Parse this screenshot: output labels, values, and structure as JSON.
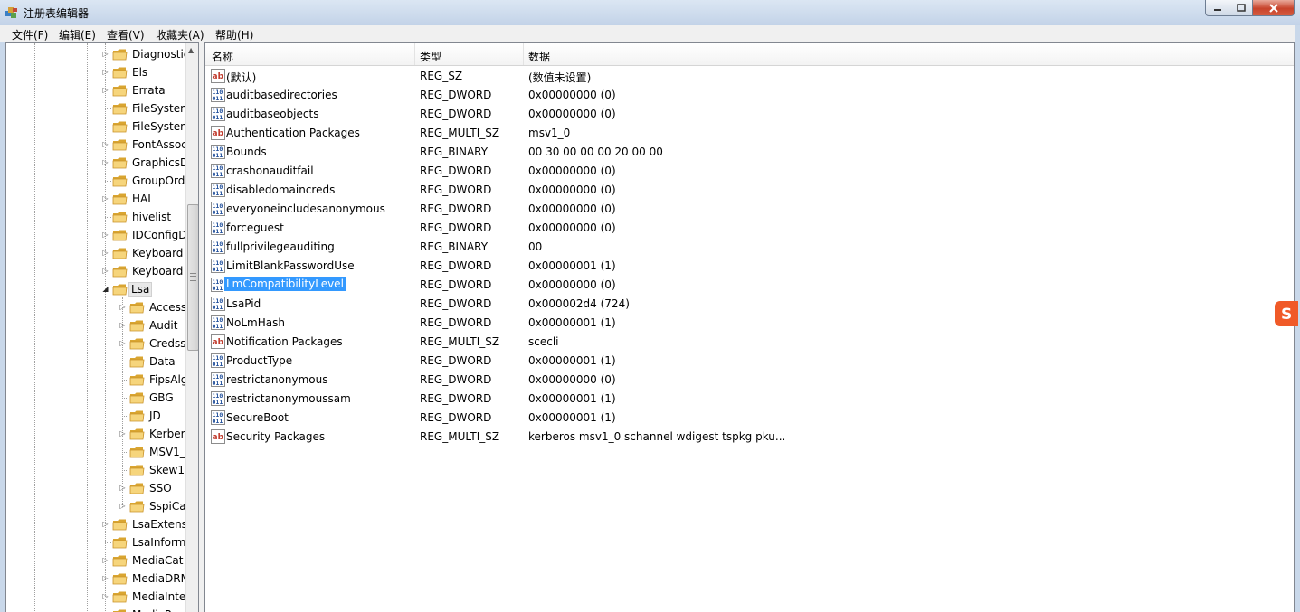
{
  "window": {
    "title": "注册表编辑器"
  },
  "menu": [
    "文件(F)",
    "编辑(E)",
    "查看(V)",
    "收藏夹(A)",
    "帮助(H)"
  ],
  "tree": {
    "items": [
      {
        "label": "Diagnostic",
        "level": 1,
        "expandable": true
      },
      {
        "label": "Els",
        "level": 1,
        "expandable": true
      },
      {
        "label": "Errata",
        "level": 1,
        "expandable": true
      },
      {
        "label": "FileSystem",
        "level": 1,
        "expandable": false
      },
      {
        "label": "FileSystem",
        "level": 1,
        "expandable": false
      },
      {
        "label": "FontAssoc",
        "level": 1,
        "expandable": true
      },
      {
        "label": "GraphicsD",
        "level": 1,
        "expandable": true
      },
      {
        "label": "GroupOrd",
        "level": 1,
        "expandable": false
      },
      {
        "label": "HAL",
        "level": 1,
        "expandable": true
      },
      {
        "label": "hivelist",
        "level": 1,
        "expandable": false
      },
      {
        "label": "IDConfigD",
        "level": 1,
        "expandable": true
      },
      {
        "label": "Keyboard",
        "level": 1,
        "expandable": true
      },
      {
        "label": "Keyboard",
        "level": 1,
        "expandable": true
      },
      {
        "label": "Lsa",
        "level": 1,
        "expandable": true,
        "expanded": true,
        "selected": true
      },
      {
        "label": "Access",
        "level": 2,
        "expandable": true
      },
      {
        "label": "Audit",
        "level": 2,
        "expandable": true
      },
      {
        "label": "Credss",
        "level": 2,
        "expandable": true
      },
      {
        "label": "Data",
        "level": 2,
        "expandable": false
      },
      {
        "label": "FipsAlg",
        "level": 2,
        "expandable": false
      },
      {
        "label": "GBG",
        "level": 2,
        "expandable": false
      },
      {
        "label": "JD",
        "level": 2,
        "expandable": false
      },
      {
        "label": "Kerber",
        "level": 2,
        "expandable": true
      },
      {
        "label": "MSV1_",
        "level": 2,
        "expandable": false
      },
      {
        "label": "Skew1",
        "level": 2,
        "expandable": false
      },
      {
        "label": "SSO",
        "level": 2,
        "expandable": true
      },
      {
        "label": "SspiCa",
        "level": 2,
        "expandable": true
      },
      {
        "label": "LsaExtens",
        "level": 1,
        "expandable": true
      },
      {
        "label": "LsaInform",
        "level": 1,
        "expandable": false
      },
      {
        "label": "MediaCat",
        "level": 1,
        "expandable": true
      },
      {
        "label": "MediaDRM",
        "level": 1,
        "expandable": true
      },
      {
        "label": "MediaInte",
        "level": 1,
        "expandable": true
      },
      {
        "label": "MediaP",
        "level": 1,
        "expandable": true
      }
    ]
  },
  "list": {
    "columns": [
      "名称",
      "类型",
      "数据"
    ],
    "rows": [
      {
        "icon": "string-value-icon",
        "name": "(默认)",
        "type": "REG_SZ",
        "data": "(数值未设置)"
      },
      {
        "icon": "binary-value-icon",
        "name": "auditbasedirectories",
        "type": "REG_DWORD",
        "data": "0x00000000 (0)"
      },
      {
        "icon": "binary-value-icon",
        "name": "auditbaseobjects",
        "type": "REG_DWORD",
        "data": "0x00000000 (0)"
      },
      {
        "icon": "string-value-icon",
        "name": "Authentication Packages",
        "type": "REG_MULTI_SZ",
        "data": "msv1_0"
      },
      {
        "icon": "binary-value-icon",
        "name": "Bounds",
        "type": "REG_BINARY",
        "data": "00 30 00 00 00 20 00 00"
      },
      {
        "icon": "binary-value-icon",
        "name": "crashonauditfail",
        "type": "REG_DWORD",
        "data": "0x00000000 (0)"
      },
      {
        "icon": "binary-value-icon",
        "name": "disabledomaincreds",
        "type": "REG_DWORD",
        "data": "0x00000000 (0)"
      },
      {
        "icon": "binary-value-icon",
        "name": "everyoneincludesanonymous",
        "type": "REG_DWORD",
        "data": "0x00000000 (0)"
      },
      {
        "icon": "binary-value-icon",
        "name": "forceguest",
        "type": "REG_DWORD",
        "data": "0x00000000 (0)"
      },
      {
        "icon": "binary-value-icon",
        "name": "fullprivilegeauditing",
        "type": "REG_BINARY",
        "data": "00"
      },
      {
        "icon": "binary-value-icon",
        "name": "LimitBlankPasswordUse",
        "type": "REG_DWORD",
        "data": "0x00000001 (1)"
      },
      {
        "icon": "binary-value-icon",
        "name": "LmCompatibilityLevel",
        "type": "REG_DWORD",
        "data": "0x00000000 (0)",
        "selected": true
      },
      {
        "icon": "binary-value-icon",
        "name": "LsaPid",
        "type": "REG_DWORD",
        "data": "0x000002d4 (724)"
      },
      {
        "icon": "binary-value-icon",
        "name": "NoLmHash",
        "type": "REG_DWORD",
        "data": "0x00000001 (1)"
      },
      {
        "icon": "string-value-icon",
        "name": "Notification Packages",
        "type": "REG_MULTI_SZ",
        "data": "scecli"
      },
      {
        "icon": "binary-value-icon",
        "name": "ProductType",
        "type": "REG_DWORD",
        "data": "0x00000001 (1)"
      },
      {
        "icon": "binary-value-icon",
        "name": "restrictanonymous",
        "type": "REG_DWORD",
        "data": "0x00000000 (0)"
      },
      {
        "icon": "binary-value-icon",
        "name": "restrictanonymoussam",
        "type": "REG_DWORD",
        "data": "0x00000001 (1)"
      },
      {
        "icon": "binary-value-icon",
        "name": "SecureBoot",
        "type": "REG_DWORD",
        "data": "0x00000001 (1)"
      },
      {
        "icon": "string-value-icon",
        "name": "Security Packages",
        "type": "REG_MULTI_SZ",
        "data": "kerberos msv1_0 schannel wdigest tspkg pku..."
      }
    ]
  },
  "colors": {
    "selection": "#3399ff",
    "folder": "#e8b84a",
    "titlebar": "#c3d3e8"
  }
}
